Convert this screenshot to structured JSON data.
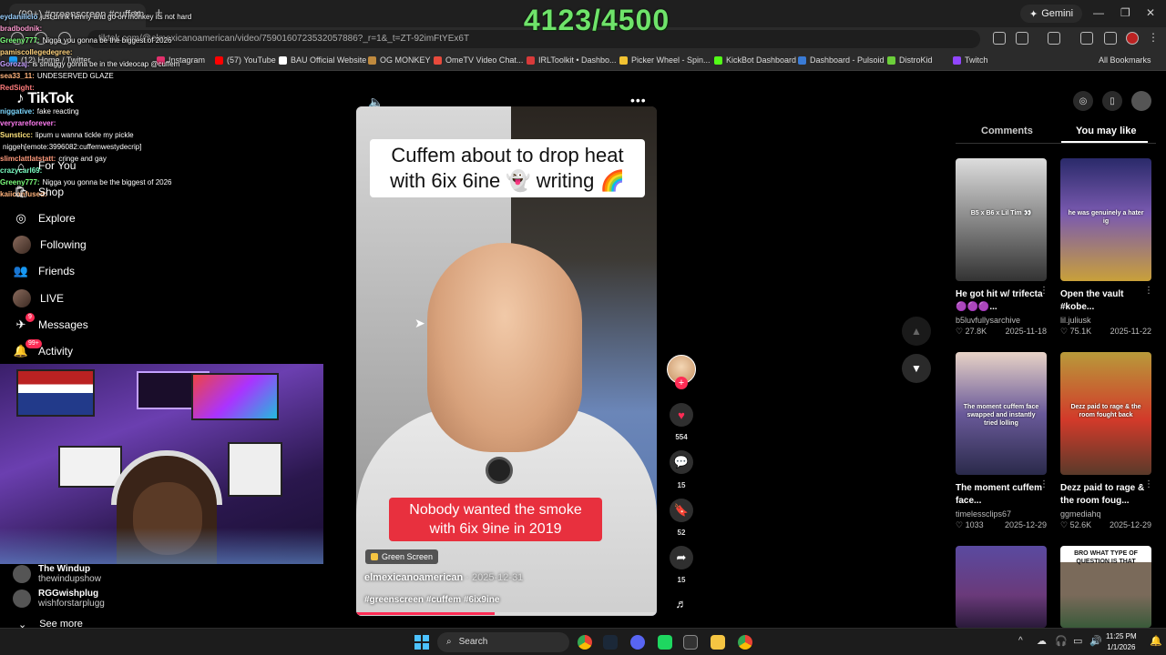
{
  "browser": {
    "tab_title": "(99+) #greenscreen #cuffem #",
    "gemini_label": "Gemini",
    "url": "tiktok.com/@elmexicanoamerican/video/7590160723532057886?_r=1&_t=ZT-92imFtYEx6T",
    "bookmarks": [
      {
        "label": "(12) Home / Twitter",
        "color": "#1d9bf0"
      },
      {
        "label": "Instagram",
        "color": "#e1306c"
      },
      {
        "label": "(57) YouTube",
        "color": "#ff0000"
      },
      {
        "label": "BAU Official Website",
        "color": "#ffffff"
      },
      {
        "label": "OG MONKEY",
        "color": "#c08a3e"
      },
      {
        "label": "OmeTV Video Chat...",
        "color": "#e84a3c"
      },
      {
        "label": "IRLToolkit • Dashbo...",
        "color": "#d83a3a"
      },
      {
        "label": "Picker Wheel - Spin...",
        "color": "#f1c232"
      },
      {
        "label": "KickBot Dashboard",
        "color": "#53fc18"
      },
      {
        "label": "Dashboard - Pulsoid",
        "color": "#3a7bd5"
      },
      {
        "label": "DistroKid",
        "color": "#6ccf3a"
      },
      {
        "label": "Twitch",
        "color": "#9146ff"
      }
    ],
    "all_bookmarks": "All Bookmarks"
  },
  "overlay": {
    "counter": "4123/4500"
  },
  "chat": [
    {
      "user": "eydanilicio",
      "text": "just drink henny and go on monkey its not hard",
      "color": "#9ad0ff"
    },
    {
      "user": "bradbodnik:",
      "text": "",
      "color": "#ff9ad0"
    },
    {
      "user": "Greeny777:",
      "text": "Nigga you gonna be the biggest of 2026",
      "color": "#7cff7c"
    },
    {
      "user": "pamiscollegedegree:",
      "text": "",
      "color": "#ffd27c"
    },
    {
      "user": "Gorozaj:",
      "text": "is smaggy gonna be in the videocap @cuffem",
      "color": "#c7a0ff"
    },
    {
      "user": "sea33_11:",
      "text": "UNDESERVED GLAZE",
      "color": "#ffb37c"
    },
    {
      "user": "RedSight:",
      "text": "",
      "color": "#ff7c7c"
    },
    {
      "user": "",
      "text": "",
      "color": "#ffffff"
    },
    {
      "user": "niggative:",
      "text": "fake reacting",
      "color": "#7cd8ff"
    },
    {
      "user": "veryrareforever:",
      "text": "",
      "color": "#ff7cf2"
    },
    {
      "user": "Sunsticc:",
      "text": "lipum u wanna tickle my pickle",
      "color": "#ffe37c"
    },
    {
      "user": "",
      "text": "niggeh[emote:3996082:cuffemwestydecrip]",
      "color": "#ffffff"
    },
    {
      "user": "slimclattlatstatt:",
      "text": "cringe and gay",
      "color": "#ff9a7c"
    },
    {
      "user": "crazycarl69:",
      "text": "",
      "color": "#7cffc4"
    },
    {
      "user": "Greeny777:",
      "text": "Nigga you gonna be the biggest of 2026",
      "color": "#7cff7c"
    },
    {
      "user": "kaiiconfused:",
      "text": "",
      "color": "#ffb37c"
    }
  ],
  "tiktok": {
    "logo": "TikTok",
    "nav": [
      {
        "label": "For You",
        "icon": "home-icon"
      },
      {
        "label": "Shop",
        "icon": "shop-icon"
      },
      {
        "label": "Explore",
        "icon": "compass-icon"
      },
      {
        "label": "Following",
        "icon": "avatar"
      },
      {
        "label": "Friends",
        "icon": "friends-icon"
      },
      {
        "label": "LIVE",
        "icon": "avatar"
      },
      {
        "label": "Messages",
        "icon": "send-icon",
        "badge": "9"
      },
      {
        "label": "Activity",
        "icon": "bell-icon",
        "badge": "99+"
      }
    ],
    "following_accounts": [
      {
        "name": "The Windup",
        "handle": "thewindupshow"
      },
      {
        "name": "RGGwishplug",
        "handle": "wishforstarplugg"
      }
    ],
    "see_more": "See more"
  },
  "video": {
    "caption_top": "Cuffem about to drop heat with 6ix 6ine 👻 writing 🌈",
    "caption_bottom": "Nobody wanted the smoke with 6ix 9ine in 2019",
    "effect_tag": "Green Screen",
    "author": "elmexicanoamerican",
    "date": "2025-12-31",
    "hashtags": "#greenscreen #cuffem #6ix9ine",
    "progress": 0.46,
    "likes": "554",
    "comments": "15",
    "saves": "52",
    "shares": "15"
  },
  "right_panel": {
    "tabs": [
      "Comments",
      "You may like"
    ],
    "active_tab": "You may like",
    "cards": [
      {
        "title": "He got hit w/ trifecta 🟣🟣🟣...",
        "author": "b5luvfullysarchive",
        "likes": "27.8K",
        "date": "2025-11-18",
        "thumb_text": "B5 x B6 x Lil Tim 👀"
      },
      {
        "title": "Open the vault #kobe...",
        "author": "lil.juliusk",
        "likes": "75.1K",
        "date": "2025-11-22",
        "thumb_text": "he was genuinely a hater ig"
      },
      {
        "title": "The moment cuffem face...",
        "author": "timelessclips67",
        "likes": "1033",
        "date": "2025-12-29",
        "thumb_text": "The moment cuffem face swapped and instantly tried lolling"
      },
      {
        "title": "Dezz paid to rage & the room foug...",
        "author": "ggmediahq",
        "likes": "52.6K",
        "date": "2025-12-29",
        "thumb_text": "Dezz paid to rage & the room fought back"
      },
      {
        "title": "",
        "author": "",
        "likes": "",
        "date": "",
        "thumb_text": ""
      },
      {
        "title": "",
        "author": "",
        "likes": "",
        "date": "",
        "thumb_text": "BRO WHAT TYPE OF QUESTION IS THAT"
      }
    ]
  },
  "taskbar": {
    "search": "Search",
    "time": "11:25 PM",
    "date": "1/1/2026"
  }
}
